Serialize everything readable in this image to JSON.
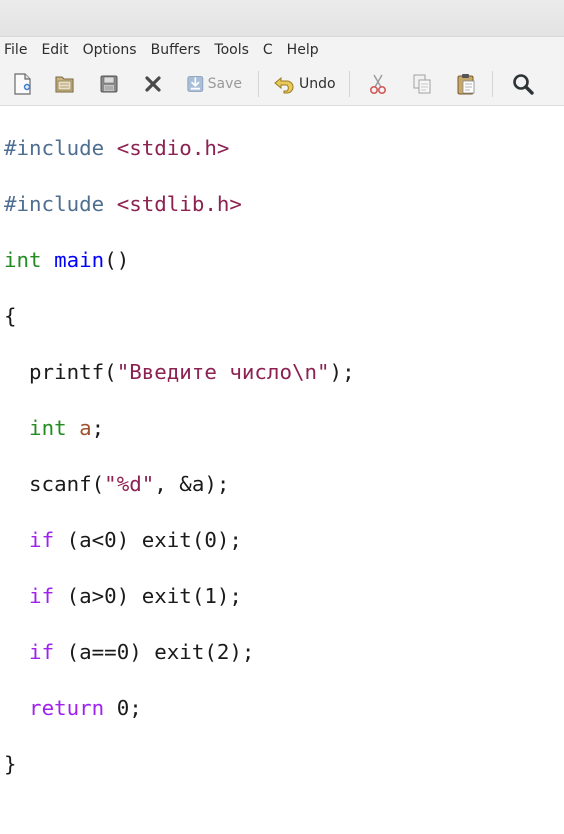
{
  "menu": [
    "File",
    "Edit",
    "Options",
    "Buffers",
    "Tools",
    "C",
    "Help"
  ],
  "toolbar": {
    "save_label": "Save",
    "undo_label": "Undo",
    "icons": [
      "new-file-icon",
      "open-folder-icon",
      "save-disk-icon",
      "close-x-icon",
      "save-icon",
      "undo-icon",
      "cut-icon",
      "copy-icon",
      "paste-icon",
      "search-icon"
    ]
  },
  "code": {
    "l1": {
      "a": "#include",
      "b": " ",
      "c": "<stdio.h>"
    },
    "l2": {
      "a": "#include",
      "b": " ",
      "c": "<stdlib.h>"
    },
    "l3": {
      "a": "int",
      "b": " ",
      "c": "main",
      "d": "()"
    },
    "l4": {
      "a": "{"
    },
    "l5": {
      "a": "  printf(",
      "b": "\"Введите число\\n\"",
      "c": ");"
    },
    "l6": {
      "a": "  ",
      "b": "int",
      "c": " ",
      "d": "a",
      "e": ";"
    },
    "l7": {
      "a": "  scanf(",
      "b": "\"%d\"",
      "c": ", &a);"
    },
    "l8": {
      "a": "  ",
      "b": "if",
      "c": " (a<0) exit(0);"
    },
    "l9": {
      "a": "  ",
      "b": "if",
      "c": " (a>0) exit(1);"
    },
    "l10": {
      "a": "  ",
      "b": "if",
      "c": " (a==0) exit(2);"
    },
    "l11": {
      "a": "  ",
      "b": "return",
      "c": " 0;"
    },
    "l12": {
      "a": "}"
    }
  },
  "colors": {
    "preprocessor": "#4f6f90",
    "string": "#8b2252",
    "type": "#228b22",
    "function": "#0000ff",
    "keyword": "#a020f0",
    "variable": "#a0522d"
  }
}
